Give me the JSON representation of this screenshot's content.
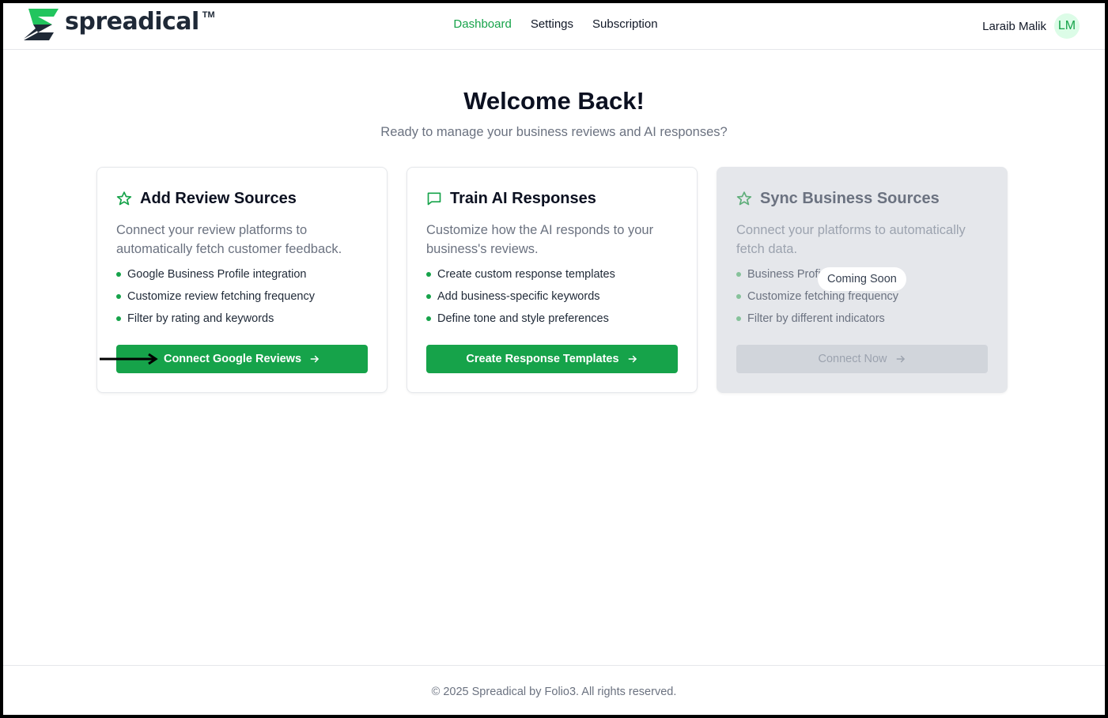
{
  "brand": {
    "name": "spreadical",
    "trademark": "TM",
    "color": "#16a34a"
  },
  "nav": {
    "items": [
      {
        "label": "Dashboard",
        "active": true
      },
      {
        "label": "Settings",
        "active": false
      },
      {
        "label": "Subscription",
        "active": false
      }
    ]
  },
  "user": {
    "name": "Laraib Malik",
    "initials": "LM"
  },
  "hero": {
    "title": "Welcome Back!",
    "subtitle": "Ready to manage your business reviews and AI responses?"
  },
  "cards": [
    {
      "icon": "star-icon",
      "title": "Add Review Sources",
      "description": "Connect your review platforms to automatically fetch customer feedback.",
      "features": [
        "Google Business Profile integration",
        "Customize review fetching frequency",
        "Filter by rating and keywords"
      ],
      "button": "Connect Google Reviews",
      "enabled": true
    },
    {
      "icon": "message-square-icon",
      "title": "Train AI Responses",
      "description": "Customize how the AI responds to your business's reviews.",
      "features": [
        "Create custom response templates",
        "Add business-specific keywords",
        "Define tone and style preferences"
      ],
      "button": "Create Response Templates",
      "enabled": true
    },
    {
      "icon": "star-icon",
      "title": "Sync Business Sources",
      "description": "Connect your platforms to automatically fetch data.",
      "features": [
        "Business Profi",
        "Customize fetching frequency",
        "Filter by different indicators"
      ],
      "button": "Connect Now",
      "badge": "Coming Soon",
      "enabled": false
    }
  ],
  "footer": {
    "text": "© 2025 Spreadical by Folio3. All rights reserved."
  }
}
